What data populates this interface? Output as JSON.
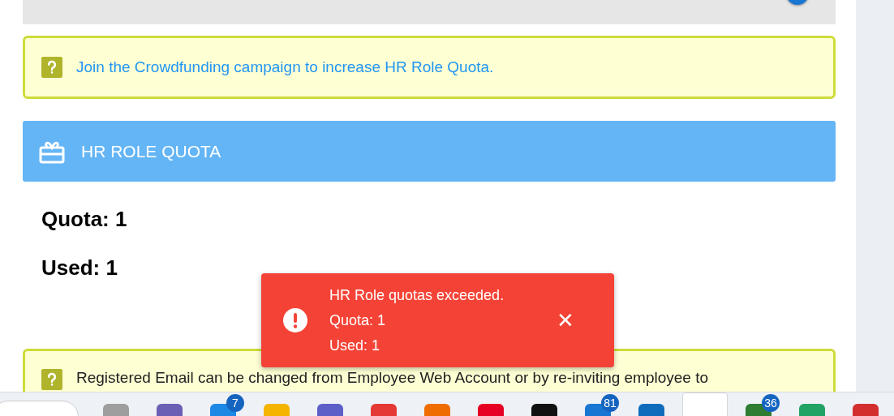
{
  "notices": [
    {
      "text": "Join the Crowdfunding campaign to increase HR Role Quota.",
      "kind": "link"
    },
    {
      "text": "Registered Email can be changed from Employee Web Account or by re-inviting employee to",
      "kind": "plain"
    }
  ],
  "panel": {
    "title": "HR ROLE QUOTA",
    "quota": "Quota: 1",
    "used": "Used: 1"
  },
  "toast": {
    "lines": [
      "HR Role quotas exceeded.",
      "Quota: 1",
      "Used: 1"
    ],
    "close": "✕"
  },
  "taskbar": {
    "items": [
      {
        "selected": false
      },
      {
        "selected": false
      },
      {
        "selected": false,
        "badge": "7"
      },
      {
        "selected": false
      },
      {
        "selected": false
      },
      {
        "selected": false
      },
      {
        "selected": false
      },
      {
        "selected": false
      },
      {
        "selected": false
      },
      {
        "selected": false,
        "badge": "81"
      },
      {
        "selected": false
      },
      {
        "selected": true
      },
      {
        "selected": false,
        "badge": "36"
      },
      {
        "selected": false
      },
      {
        "selected": false
      }
    ]
  }
}
